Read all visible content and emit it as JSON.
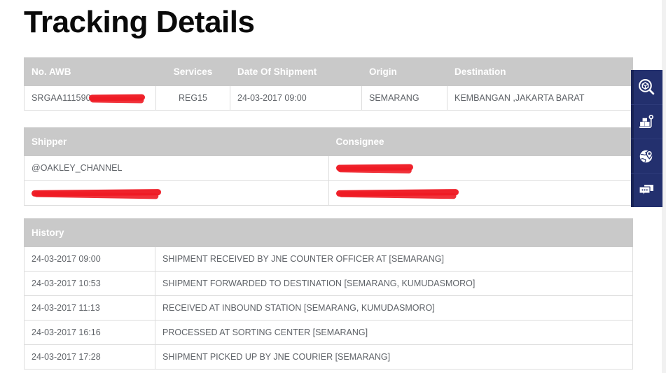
{
  "page": {
    "title": "Tracking Details"
  },
  "shipment_table": {
    "headers": {
      "awb": "No. AWB",
      "services": "Services",
      "date_of_shipment": "Date Of Shipment",
      "origin": "Origin",
      "destination": "Destination"
    },
    "row": {
      "awb_visible": "SRGAA111590",
      "awb_redacted": true,
      "services": "REG15",
      "date_of_shipment": "24-03-2017 09:00",
      "origin": "SEMARANG",
      "destination": "KEMBANGAN ,JAKARTA BARAT"
    }
  },
  "parties_table": {
    "headers": {
      "shipper": "Shipper",
      "consignee": "Consignee"
    },
    "rows": [
      {
        "shipper_name": "@OAKLEY_CHANNEL",
        "shipper_redacted": false,
        "consignee_name": "",
        "consignee_redacted": true
      },
      {
        "shipper_name": "",
        "shipper_redacted": true,
        "consignee_name": "",
        "consignee_redacted": true
      }
    ]
  },
  "history_table": {
    "header": "History",
    "rows": [
      {
        "time": "24-03-2017 09:00",
        "description": "SHIPMENT RECEIVED BY JNE COUNTER OFFICER AT [SEMARANG]"
      },
      {
        "time": "24-03-2017 10:53",
        "description": "SHIPMENT FORWARDED TO DESTINATION [SEMARANG, KUMUDASMORO]"
      },
      {
        "time": "24-03-2017 11:13",
        "description": "RECEIVED AT INBOUND STATION [SEMARANG, KUMUDASMORO]"
      },
      {
        "time": "24-03-2017 16:16",
        "description": "PROCESSED AT SORTING CENTER [SEMARANG]"
      },
      {
        "time": "24-03-2017 17:28",
        "description": "SHIPMENT PICKED UP BY JNE COURIER [SEMARANG]"
      }
    ]
  },
  "sidebar": {
    "items": [
      {
        "icon": "package-search-icon",
        "label": "Tracking"
      },
      {
        "icon": "shipping-scale-icon",
        "label": "Shipping Rate"
      },
      {
        "icon": "globe-location-pin-icon",
        "label": "Nearest Location"
      },
      {
        "icon": "chat-bubbles-icon",
        "label": "Contact"
      }
    ]
  },
  "colors": {
    "table_header_bg": "#c9c9c9",
    "table_border": "#dddddd",
    "sidebar_bg": "#23306e",
    "sidebar_edge": "#192457",
    "redaction": "#ee1b24",
    "body_text": "#5f6368",
    "title_text": "#0a0a0a"
  }
}
